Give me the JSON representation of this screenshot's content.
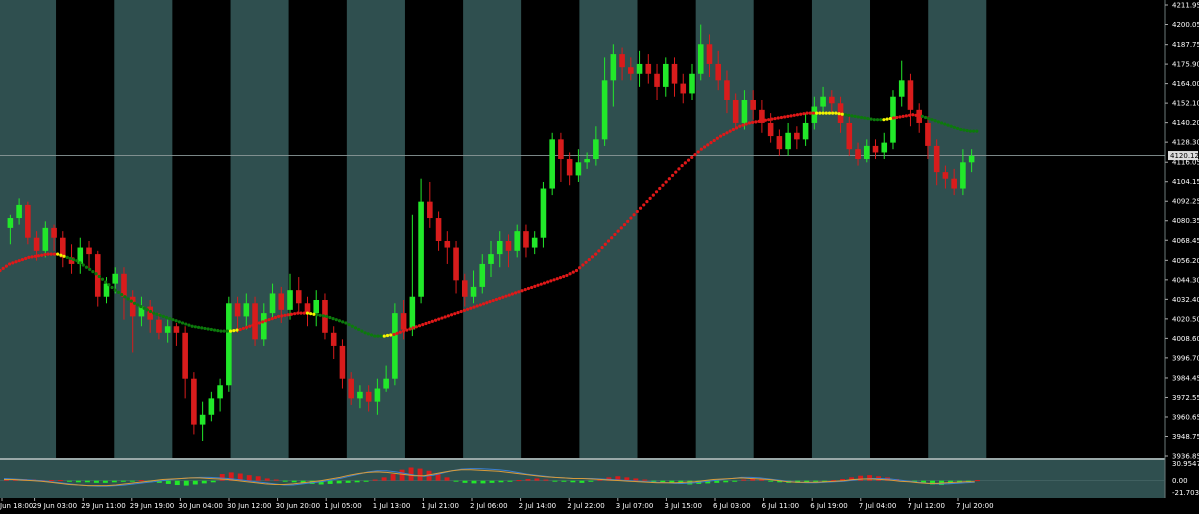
{
  "chart_data": {
    "type": "candlestick",
    "session_bands": [
      {
        "from": 0,
        "to": 1,
        "shade": "light"
      },
      {
        "from": 1,
        "to": 2,
        "shade": "dark"
      },
      {
        "from": 2,
        "to": 3,
        "shade": "light"
      },
      {
        "from": 3,
        "to": 4,
        "shade": "dark"
      },
      {
        "from": 4,
        "to": 5,
        "shade": "light"
      },
      {
        "from": 5,
        "to": 6,
        "shade": "dark"
      },
      {
        "from": 6,
        "to": 7,
        "shade": "light"
      },
      {
        "from": 7,
        "to": 8,
        "shade": "dark"
      },
      {
        "from": 8,
        "to": 9,
        "shade": "light"
      },
      {
        "from": 9,
        "to": 10,
        "shade": "dark"
      },
      {
        "from": 10,
        "to": 11,
        "shade": "light"
      },
      {
        "from": 11,
        "to": 12,
        "shade": "dark"
      },
      {
        "from": 12,
        "to": 13,
        "shade": "light"
      },
      {
        "from": 13,
        "to": 14,
        "shade": "dark"
      },
      {
        "from": 14,
        "to": 15,
        "shade": "light"
      },
      {
        "from": 15,
        "to": 16,
        "shade": "dark"
      },
      {
        "from": 16,
        "to": 17,
        "shade": "light"
      },
      {
        "from": 17,
        "to": 18,
        "shade": "dark"
      }
    ],
    "main_axis": {
      "ylim": [
        3936.85,
        4211.95
      ],
      "ticks": [
        "4211.95",
        "4200.05",
        "4187.75",
        "4175.90",
        "4164.00",
        "4152.10",
        "4140.20",
        "4128.30",
        "4116.05",
        "4104.15",
        "4092.25",
        "4080.35",
        "4068.45",
        "4056.20",
        "4044.30",
        "4032.40",
        "4020.50",
        "4008.60",
        "3996.70",
        "3984.45",
        "3972.55",
        "3960.65",
        "3948.75",
        "3936.85"
      ],
      "current_price": "4120.12"
    },
    "x_ticks": [
      "Jun 18:00",
      "29 Jun 03:00",
      "29 Jun 11:00",
      "29 Jun 19:00",
      "30 Jun 04:00",
      "30 Jun 12:00",
      "30 Jun 20:00",
      "1 Jul 05:00",
      "1 Jul 13:00",
      "1 Jul 21:00",
      "2 Jul 06:00",
      "2 Jul 14:00",
      "2 Jul 22:00",
      "3 Jul 07:00",
      "3 Jul 15:00",
      "6 Jul 03:00",
      "6 Jul 11:00",
      "6 Jul 19:00",
      "7 Jul 04:00",
      "7 Jul 12:00",
      "7 Jul 20:00"
    ],
    "candles": [
      [
        4076,
        4082,
        4066,
        4084
      ],
      [
        4082,
        4090,
        4078,
        4094
      ],
      [
        4090,
        4070,
        4066,
        4092
      ],
      [
        4070,
        4062,
        4056,
        4074
      ],
      [
        4062,
        4076,
        4058,
        4080
      ],
      [
        4076,
        4070,
        4062,
        4078
      ],
      [
        4070,
        4058,
        4052,
        4074
      ],
      [
        4058,
        4054,
        4048,
        4066
      ],
      [
        4054,
        4064,
        4048,
        4070
      ],
      [
        4064,
        4060,
        4050,
        4068
      ],
      [
        4060,
        4034,
        4028,
        4062
      ],
      [
        4034,
        4042,
        4030,
        4046
      ],
      [
        4042,
        4048,
        4036,
        4052
      ],
      [
        4048,
        4034,
        4020,
        4052
      ],
      [
        4034,
        4022,
        4000,
        4038
      ],
      [
        4022,
        4028,
        4016,
        4034
      ],
      [
        4028,
        4020,
        4012,
        4032
      ],
      [
        4020,
        4012,
        4008,
        4024
      ],
      [
        4012,
        4016,
        4006,
        4020
      ],
      [
        4016,
        4012,
        4004,
        4018
      ],
      [
        4012,
        3984,
        3972,
        4016
      ],
      [
        3984,
        3956,
        3950,
        3988
      ],
      [
        3956,
        3962,
        3946,
        3970
      ],
      [
        3962,
        3972,
        3958,
        3976
      ],
      [
        3972,
        3980,
        3964,
        3984
      ],
      [
        3980,
        4030,
        3976,
        4034
      ],
      [
        4030,
        4022,
        4012,
        4034
      ],
      [
        4022,
        4030,
        4014,
        4036
      ],
      [
        4030,
        4008,
        4004,
        4034
      ],
      [
        4008,
        4024,
        4004,
        4030
      ],
      [
        4024,
        4036,
        4020,
        4042
      ],
      [
        4036,
        4026,
        4018,
        4040
      ],
      [
        4026,
        4038,
        4020,
        4048
      ],
      [
        4038,
        4030,
        4024,
        4046
      ],
      [
        4030,
        4024,
        4016,
        4034
      ],
      [
        4024,
        4032,
        4016,
        4038
      ],
      [
        4032,
        4012,
        4008,
        4036
      ],
      [
        4012,
        4004,
        3996,
        4016
      ],
      [
        4004,
        3984,
        3978,
        4008
      ],
      [
        3984,
        3972,
        3968,
        3988
      ],
      [
        3972,
        3976,
        3966,
        3980
      ],
      [
        3976,
        3970,
        3964,
        3980
      ],
      [
        3970,
        3978,
        3962,
        3984
      ],
      [
        3978,
        3984,
        3976,
        3992
      ],
      [
        3984,
        4024,
        3980,
        4030
      ],
      [
        4024,
        4014,
        4008,
        4032
      ],
      [
        4014,
        4034,
        4010,
        4084
      ],
      [
        4034,
        4092,
        4030,
        4106
      ],
      [
        4092,
        4082,
        4076,
        4104
      ],
      [
        4082,
        4068,
        4062,
        4086
      ],
      [
        4068,
        4064,
        4054,
        4074
      ],
      [
        4064,
        4044,
        4036,
        4068
      ],
      [
        4044,
        4034,
        4028,
        4048
      ],
      [
        4034,
        4040,
        4030,
        4050
      ],
      [
        4040,
        4054,
        4036,
        4060
      ],
      [
        4054,
        4060,
        4046,
        4068
      ],
      [
        4060,
        4068,
        4052,
        4074
      ],
      [
        4068,
        4062,
        4052,
        4072
      ],
      [
        4062,
        4074,
        4058,
        4078
      ],
      [
        4074,
        4064,
        4058,
        4078
      ],
      [
        4064,
        4070,
        4060,
        4074
      ],
      [
        4070,
        4100,
        4064,
        4104
      ],
      [
        4100,
        4130,
        4096,
        4134
      ],
      [
        4130,
        4118,
        4104,
        4134
      ],
      [
        4118,
        4108,
        4102,
        4122
      ],
      [
        4108,
        4116,
        4104,
        4124
      ],
      [
        4116,
        4118,
        4112,
        4122
      ],
      [
        4118,
        4130,
        4114,
        4138
      ],
      [
        4130,
        4166,
        4126,
        4180
      ],
      [
        4166,
        4182,
        4150,
        4188
      ],
      [
        4182,
        4174,
        4166,
        4186
      ],
      [
        4174,
        4170,
        4166,
        4180
      ],
      [
        4170,
        4176,
        4162,
        4184
      ],
      [
        4176,
        4170,
        4164,
        4182
      ],
      [
        4170,
        4162,
        4154,
        4176
      ],
      [
        4162,
        4176,
        4156,
        4180
      ],
      [
        4176,
        4164,
        4156,
        4180
      ],
      [
        4164,
        4158,
        4152,
        4170
      ],
      [
        4158,
        4170,
        4154,
        4176
      ],
      [
        4170,
        4188,
        4166,
        4200
      ],
      [
        4188,
        4176,
        4168,
        4194
      ],
      [
        4176,
        4166,
        4160,
        4184
      ],
      [
        4166,
        4154,
        4146,
        4172
      ],
      [
        4154,
        4140,
        4136,
        4158
      ],
      [
        4140,
        4154,
        4136,
        4160
      ],
      [
        4154,
        4148,
        4142,
        4160
      ],
      [
        4148,
        4140,
        4134,
        4154
      ],
      [
        4140,
        4132,
        4128,
        4146
      ],
      [
        4132,
        4124,
        4120,
        4136
      ],
      [
        4124,
        4134,
        4120,
        4140
      ],
      [
        4134,
        4130,
        4124,
        4138
      ],
      [
        4130,
        4140,
        4126,
        4146
      ],
      [
        4140,
        4150,
        4136,
        4156
      ],
      [
        4150,
        4156,
        4146,
        4162
      ],
      [
        4156,
        4152,
        4146,
        4160
      ],
      [
        4152,
        4140,
        4134,
        4156
      ],
      [
        4140,
        4124,
        4120,
        4144
      ],
      [
        4124,
        4118,
        4114,
        4128
      ],
      [
        4118,
        4126,
        4116,
        4130
      ],
      [
        4126,
        4122,
        4118,
        4130
      ],
      [
        4122,
        4128,
        4118,
        4134
      ],
      [
        4128,
        4156,
        4124,
        4160
      ],
      [
        4156,
        4166,
        4150,
        4178
      ],
      [
        4166,
        4148,
        4138,
        4170
      ],
      [
        4148,
        4140,
        4134,
        4152
      ],
      [
        4140,
        4126,
        4118,
        4144
      ],
      [
        4126,
        4110,
        4102,
        4130
      ],
      [
        4110,
        4106,
        4100,
        4114
      ],
      [
        4106,
        4100,
        4096,
        4112
      ],
      [
        4100,
        4116,
        4096,
        4124
      ],
      [
        4116,
        4120,
        4110,
        4124
      ]
    ],
    "trend_line": [
      4050,
      4054,
      4056,
      4058,
      4059,
      4060,
      4060,
      4058,
      4056,
      4052,
      4048,
      4043,
      4038,
      4034,
      4030,
      4027,
      4024,
      4022,
      4020,
      4018,
      4016,
      4015,
      4014,
      4013,
      4013,
      4014,
      4016,
      4018,
      4020,
      4022,
      4023,
      4024,
      4024,
      4023,
      4022,
      4020,
      4018,
      4015,
      4012,
      4010,
      4010,
      4011,
      4013,
      4015,
      4017,
      4019,
      4021,
      4023,
      4025,
      4027,
      4029,
      4031,
      4033,
      4035,
      4037,
      4039,
      4041,
      4043,
      4045,
      4047,
      4050,
      4055,
      4060,
      4066,
      4072,
      4078,
      4084,
      4090,
      4096,
      4102,
      4108,
      4114,
      4119,
      4124,
      4128,
      4132,
      4135,
      4138,
      4140,
      4141,
      4142,
      4143,
      4144,
      4145,
      4146,
      4146,
      4146,
      4146,
      4145,
      4144,
      4143,
      4142,
      4142,
      4143,
      4144,
      4145,
      4144,
      4142,
      4140,
      4138,
      4136,
      4135
    ],
    "oscillator": {
      "ticks": [
        "30.9547",
        "0.00",
        "-21.7039"
      ],
      "ylim": [
        -28,
        34
      ],
      "histogram": [
        2,
        3,
        3,
        2,
        1,
        1,
        1,
        -2,
        -3,
        -3,
        -4,
        -4,
        -3,
        -2,
        -1,
        1,
        -2,
        -4,
        -6,
        -8,
        -9,
        -7,
        -5,
        -3,
        12,
        15,
        13,
        10,
        8,
        4,
        2,
        -1,
        -3,
        -5,
        -6,
        -7,
        -6,
        -5,
        -4,
        -3,
        -2,
        2,
        6,
        12,
        20,
        24,
        22,
        18,
        12,
        6,
        -1,
        -4,
        -5,
        -5,
        -4,
        -3,
        -2,
        1,
        3,
        4,
        2,
        -1,
        -2,
        -3,
        -4,
        -2,
        2,
        6,
        8,
        6,
        4,
        2,
        -1,
        -3,
        -5,
        -6,
        -7,
        -6,
        -5,
        -4,
        -3,
        -2,
        2,
        4,
        2,
        -1,
        -3,
        -4,
        -4,
        -3,
        -2,
        -1,
        1,
        3,
        6,
        9,
        10,
        8,
        6,
        3,
        -1,
        -3,
        -5,
        -7,
        -8,
        -6,
        -4,
        -2,
        1
      ],
      "line_blue": [
        4,
        3,
        2,
        1,
        0,
        -2,
        -4,
        -6,
        -8,
        -9,
        -10,
        -10,
        -9,
        -8,
        -6,
        -4,
        -2,
        0,
        2,
        4,
        5,
        6,
        6,
        5,
        4,
        2,
        0,
        -2,
        -4,
        -6,
        -8,
        -8,
        -6,
        -4,
        -2,
        1,
        4,
        8,
        12,
        16,
        18,
        18,
        16,
        13,
        10,
        8,
        10,
        14,
        18,
        21,
        22,
        22,
        21,
        20,
        18,
        15,
        12,
        10,
        8,
        6,
        5,
        4,
        4,
        4,
        3,
        2,
        1,
        0,
        -1,
        -2,
        -3,
        -4,
        -5,
        -5,
        -4,
        -2,
        0,
        2,
        4,
        6,
        6,
        5,
        3,
        1,
        -1,
        -3,
        -4,
        -4,
        -3,
        -2,
        -1,
        1,
        3,
        4,
        4,
        3,
        1,
        -1,
        -3,
        -5,
        -6,
        -6,
        -5,
        -4,
        -3
      ],
      "line_orange": [
        2,
        2,
        1,
        0,
        -1,
        -3,
        -5,
        -7,
        -8,
        -9,
        -9,
        -9,
        -8,
        -6,
        -4,
        -2,
        0,
        2,
        3,
        4,
        5,
        5,
        4,
        3,
        2,
        0,
        -2,
        -4,
        -6,
        -7,
        -7,
        -6,
        -4,
        -2,
        0,
        3,
        6,
        10,
        13,
        15,
        16,
        15,
        13,
        11,
        9,
        9,
        12,
        15,
        18,
        20,
        20,
        19,
        18,
        17,
        15,
        13,
        11,
        9,
        7,
        6,
        5,
        4,
        4,
        3,
        2,
        1,
        0,
        -1,
        -2,
        -3,
        -4,
        -4,
        -4,
        -3,
        -2,
        0,
        2,
        3,
        4,
        5,
        4,
        3,
        2,
        0,
        -2,
        -3,
        -3,
        -3,
        -2,
        -1,
        0,
        2,
        3,
        3,
        2,
        1,
        -1,
        -2,
        -4,
        -5,
        -5,
        -4,
        -3,
        -2,
        -2
      ]
    }
  },
  "colors": {
    "bull": "#22e82a",
    "bear": "#d81c1c",
    "trend_up": "#e01818",
    "trend_down": "#0c7a0c",
    "trend_flat": "#f5f500",
    "band_light": "#2f4f4f",
    "band_dark": "#000000",
    "axis_text": "#ffffff",
    "price_line": "#8c9a9a",
    "osc_blue": "#3a7fd1",
    "osc_orange": "#d79b3a"
  }
}
